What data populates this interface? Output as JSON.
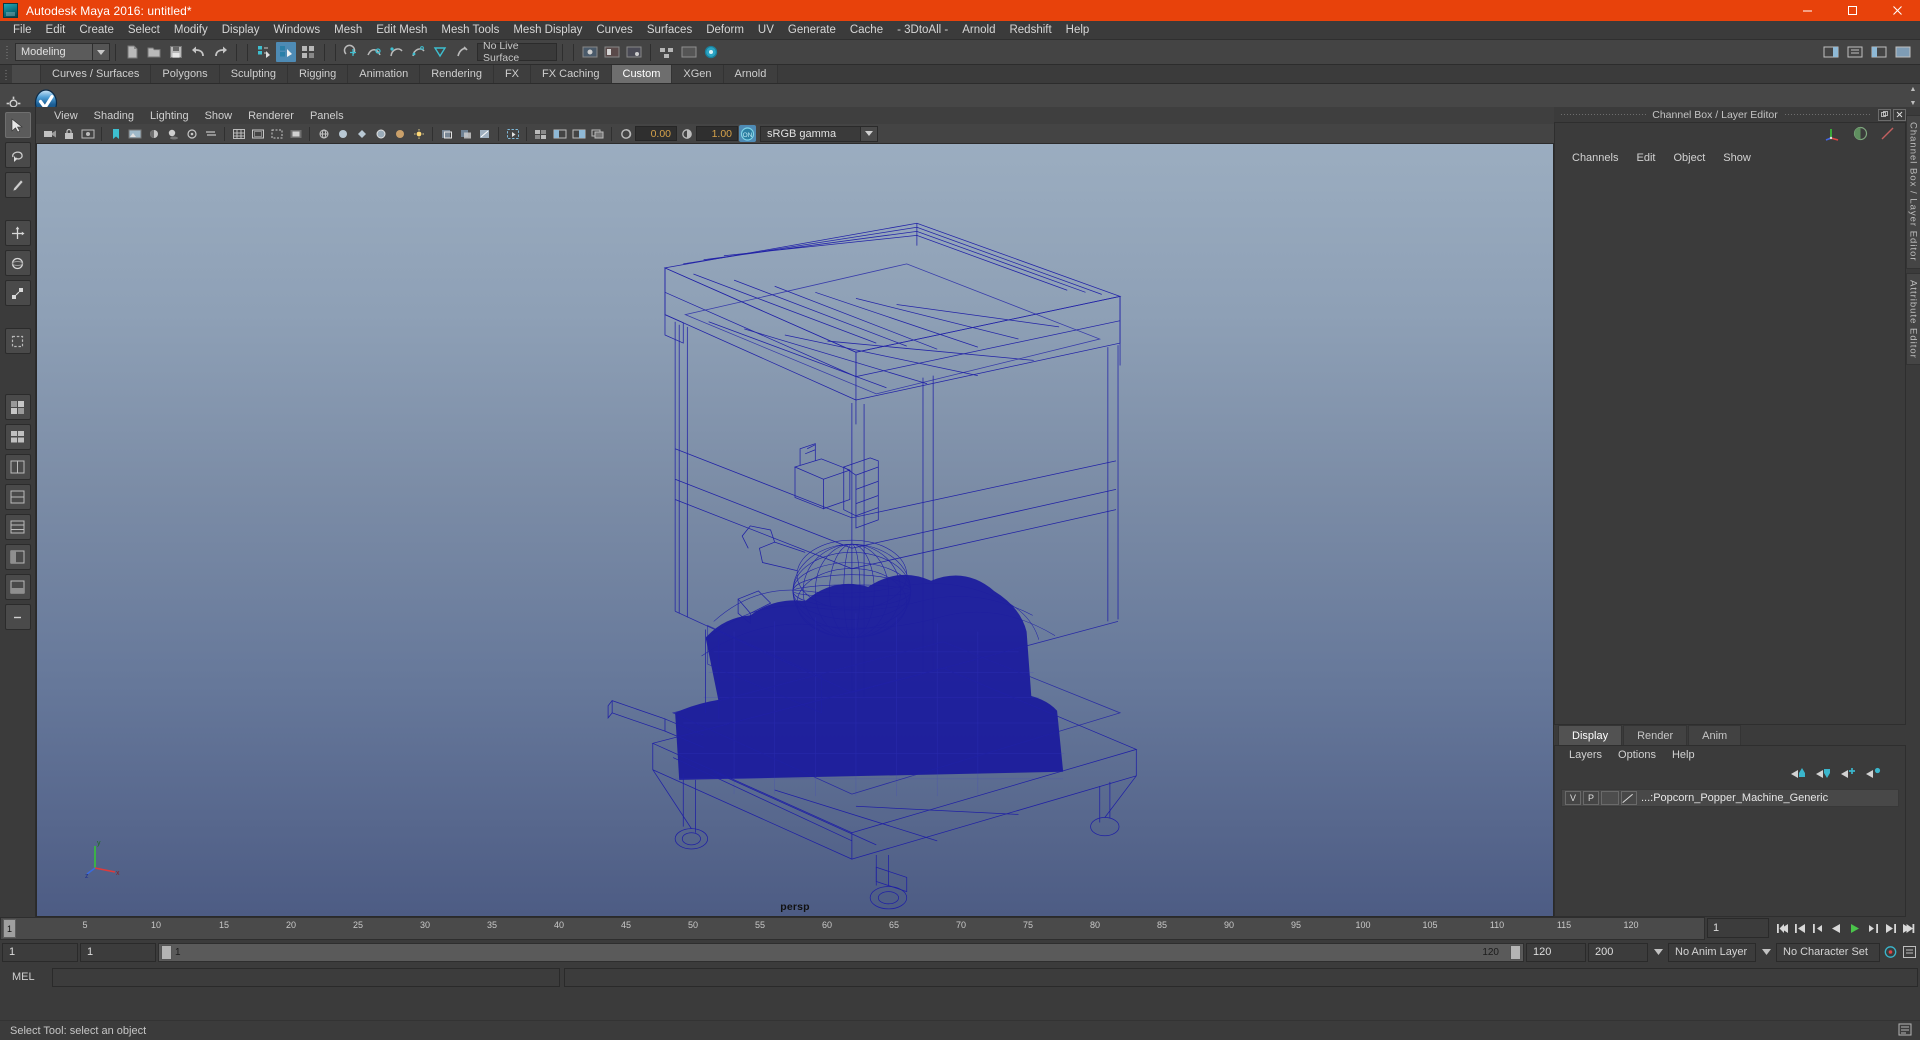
{
  "window": {
    "title": "Autodesk Maya 2016: untitled*",
    "logo_icon": "maya-logo-icon",
    "controls": [
      {
        "name": "minimize-button",
        "icon": "minimize-icon"
      },
      {
        "name": "maximize-button",
        "icon": "maximize-icon"
      },
      {
        "name": "close-button",
        "icon": "close-icon"
      }
    ],
    "accent_color": "#e8420b"
  },
  "menubar": {
    "items": [
      "File",
      "Edit",
      "Create",
      "Select",
      "Modify",
      "Display",
      "Windows",
      "Mesh",
      "Edit Mesh",
      "Mesh Tools",
      "Mesh Display",
      "Curves",
      "Surfaces",
      "Deform",
      "UV",
      "Generate",
      "Cache",
      "- 3DtoAll -",
      "Arnold",
      "Redshift",
      "Help"
    ]
  },
  "statusbar": {
    "mode_selector": "Modeling",
    "live_surface": "No Live Surface",
    "icons": [
      "new-scene-icon",
      "open-scene-icon",
      "save-scene-icon",
      "undo-icon",
      "redo-icon",
      "select-hierarchy-icon",
      "select-object-icon",
      "select-component-icon",
      "snap-grid-icon",
      "snap-curve-icon",
      "snap-point-icon",
      "snap-projected-icon",
      "snap-view-plane-icon",
      "make-live-icon"
    ],
    "right_icons": [
      "sidebar-toggle-icon",
      "attribute-editor-icon",
      "tool-settings-icon",
      "channel-box-icon"
    ]
  },
  "shelf": {
    "tabs": [
      {
        "label": "",
        "active": false
      },
      {
        "label": "Curves / Surfaces",
        "active": false
      },
      {
        "label": "Polygons",
        "active": false
      },
      {
        "label": "Sculpting",
        "active": false
      },
      {
        "label": "Rigging",
        "active": false
      },
      {
        "label": "Animation",
        "active": false
      },
      {
        "label": "Rendering",
        "active": false
      },
      {
        "label": "FX",
        "active": false
      },
      {
        "label": "FX Caching",
        "active": false
      },
      {
        "label": "Custom",
        "active": true
      },
      {
        "label": "XGen",
        "active": false
      },
      {
        "label": "Arnold",
        "active": false
      }
    ],
    "settings_icon": "shelf-settings-gear-icon",
    "buttons": [
      {
        "name": "shelf-item-checkmark",
        "icon": "blue-shield-check-icon"
      }
    ]
  },
  "toolbox": {
    "tools": [
      {
        "name": "select-tool",
        "icon": "arrow-cursor-icon",
        "selected": true
      },
      {
        "name": "lasso-select-tool",
        "icon": "lasso-icon",
        "selected": false
      },
      {
        "name": "paint-select-tool",
        "icon": "paint-brush-icon",
        "selected": false
      },
      {
        "name": "move-tool",
        "icon": "move-arrows-icon",
        "selected": false
      },
      {
        "name": "rotate-tool",
        "icon": "rotate-circle-icon",
        "selected": false
      },
      {
        "name": "scale-tool",
        "icon": "scale-box-icon",
        "selected": false
      },
      {
        "name": "last-tool-used",
        "icon": "last-tool-icon",
        "selected": false
      },
      {
        "name": "layout-single-perspective",
        "icon": "layout-single-icon",
        "selected": false
      },
      {
        "name": "layout-four-view",
        "icon": "layout-four-view-icon",
        "selected": false
      },
      {
        "name": "layout-two-pane-side",
        "icon": "layout-two-side-icon",
        "selected": false
      },
      {
        "name": "layout-two-pane-stacked",
        "icon": "layout-two-stacked-icon",
        "selected": false
      },
      {
        "name": "layout-three-pane",
        "icon": "layout-three-icon",
        "selected": false
      },
      {
        "name": "layout-persp-outliner",
        "icon": "layout-outliner-icon",
        "selected": false
      },
      {
        "name": "layout-hypergraph",
        "icon": "layout-hypergraph-icon",
        "selected": false
      },
      {
        "name": "layout-more",
        "icon": "minus-icon",
        "selected": false
      }
    ]
  },
  "viewport": {
    "menus": [
      "View",
      "Shading",
      "Lighting",
      "Show",
      "Renderer",
      "Panels"
    ],
    "camera_label": "persp",
    "toolbar": {
      "exposure_value": "0.00",
      "gamma_value": "1.00",
      "color_management_toggle": "ON",
      "color_profile": "sRGB gamma",
      "icons": [
        "select-camera-icon",
        "lock-camera-icon",
        "camera-attributes-icon",
        "bookmark-icon",
        "image-plane-icon",
        "two-sided-lighting-icon",
        "shadows-icon",
        "ambient-occlusion-icon",
        "motion-blur-icon",
        "multisample-icon",
        "grid-icon",
        "film-gate-icon",
        "resolution-gate-icon",
        "gate-mask-icon",
        "wireframe-icon",
        "smooth-shade-icon",
        "flat-shade-icon",
        "shaded-wireframe-icon",
        "textured-icon",
        "use-all-lights-icon",
        "xray-icon",
        "xray-joints-icon",
        "xray-active-components-icon",
        "isolate-select-icon",
        "exposure-icon",
        "contrast-icon",
        "color-management-icon"
      ]
    },
    "background_top": "#9badc0",
    "background_bottom": "#4d5c84",
    "model_wireframe_color": "#2020a8",
    "axis_gizmo": {
      "x": "x",
      "y": "y",
      "z": "z"
    }
  },
  "channel_box": {
    "panel_title": "Channel Box / Layer Editor",
    "menus": [
      "Channels",
      "Edit",
      "Object",
      "Show"
    ],
    "header_icons": [
      "transform-axes-icon",
      "half-circle-shading-icon",
      "diagonal-line-icon"
    ],
    "window_buttons": [
      "undock-icon",
      "close-icon"
    ],
    "content": ""
  },
  "layer_editor": {
    "tabs": [
      {
        "label": "Display",
        "active": true
      },
      {
        "label": "Render",
        "active": false
      },
      {
        "label": "Anim",
        "active": false
      }
    ],
    "menus": [
      "Layers",
      "Options",
      "Help"
    ],
    "buttons": [
      "move-layer-up-icon",
      "move-layer-down-icon",
      "new-layer-icon",
      "new-layer-from-selected-icon"
    ],
    "layers": [
      {
        "visibility": "V",
        "playback": "P",
        "name": "...:Popcorn_Popper_Machine_Generic"
      }
    ]
  },
  "vertical_tabs": [
    "Channel Box / Layer Editor",
    "Attribute Editor"
  ],
  "timeline": {
    "current_frame": "1",
    "playhead_label": "1",
    "ticks": [
      {
        "label": "5",
        "frame": 5
      },
      {
        "label": "10",
        "frame": 10
      },
      {
        "label": "15",
        "frame": 15
      },
      {
        "label": "20",
        "frame": 20
      },
      {
        "label": "25",
        "frame": 25
      },
      {
        "label": "30",
        "frame": 30
      },
      {
        "label": "35",
        "frame": 35
      },
      {
        "label": "40",
        "frame": 40
      },
      {
        "label": "45",
        "frame": 45
      },
      {
        "label": "50",
        "frame": 50
      },
      {
        "label": "55",
        "frame": 55
      },
      {
        "label": "60",
        "frame": 60
      },
      {
        "label": "65",
        "frame": 65
      },
      {
        "label": "70",
        "frame": 70
      },
      {
        "label": "75",
        "frame": 75
      },
      {
        "label": "80",
        "frame": 80
      },
      {
        "label": "85",
        "frame": 85
      },
      {
        "label": "90",
        "frame": 90
      },
      {
        "label": "95",
        "frame": 95
      },
      {
        "label": "100",
        "frame": 100
      },
      {
        "label": "105",
        "frame": 105
      },
      {
        "label": "110",
        "frame": 110
      },
      {
        "label": "115",
        "frame": 115
      },
      {
        "label": "120",
        "frame": 120
      }
    ],
    "transport_buttons": [
      "go-to-start-icon",
      "step-back-keyframe-icon",
      "step-back-frame-icon",
      "play-backwards-icon",
      "play-forwards-icon",
      "step-forward-frame-icon",
      "step-forward-keyframe-icon",
      "go-to-end-icon"
    ]
  },
  "range_slider": {
    "start_field": "1",
    "range_start_field": "1",
    "bar_start_label": "1",
    "bar_end_label": "120",
    "range_end_field": "120",
    "end_field": "200",
    "anim_layer": "No Anim Layer",
    "character_set": "No Character Set",
    "auto_key_icon": "auto-keyframe-icon",
    "anim_prefs_icon": "animation-preferences-icon"
  },
  "command_line": {
    "language_label": "MEL",
    "input_value": "",
    "output_value": ""
  },
  "status_message": "Select Tool: select an object"
}
